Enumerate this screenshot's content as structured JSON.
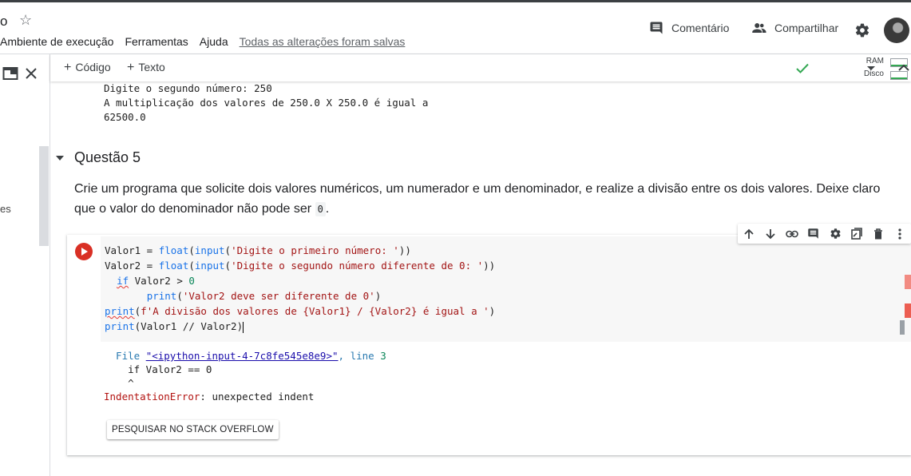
{
  "header": {
    "title_fragment": "o",
    "menu": [
      "Ambiente de execução",
      "Ferramentas",
      "Ajuda"
    ],
    "save_status": "Todas as alterações foram salvas",
    "comment_label": "Comentário",
    "share_label": "Compartilhar"
  },
  "left_panel": {
    "text_fragment": "es"
  },
  "toolbar": {
    "code_label": "Código",
    "text_label": "Texto",
    "ram_label": "RAM",
    "disk_label": "Disco"
  },
  "previous_output": {
    "lines": [
      "Digite o segundo número: 250",
      "A multiplicação dos valores de 250.0 X 250.0 é igual a",
      "62500.0"
    ]
  },
  "section": {
    "title": "Questão 5",
    "description_line1": "Crie um programa que solicite dois valores numéricos, um numerador e um denominador, e realize a divisão entre os dois valores. Deixe claro",
    "description_line2": "que o valor do denominador não pode ser",
    "description_code": "0",
    "description_end": "."
  },
  "code_cell": {
    "line1": {
      "a": "Valor1 = ",
      "fn": "float",
      "b": "(",
      "fn2": "input",
      "c": "(",
      "str": "'Digite o primeiro número: '",
      "d": "))"
    },
    "line2": {
      "a": "Valor2 = ",
      "fn": "float",
      "b": "(",
      "fn2": "input",
      "c": "(",
      "str": "'Digite o segundo número diferente de 0: '",
      "d": "))"
    },
    "line3": {
      "indent": "  ",
      "kw": "if",
      "rest": " Valor2 > ",
      "num": "0"
    },
    "line4": {
      "indent": "       ",
      "fn": "print",
      "b": "(",
      "str": "'Valor2 deve ser diferente de 0'",
      "c": ")"
    },
    "line5": {
      "fn": "print",
      "b": "(",
      "str": "f'A divisão dos valores de {Valor1} / {Valor2} é igual a '",
      "c": ")"
    },
    "line6": {
      "fn": "print",
      "rest": "(Valor1 // Valor2)"
    }
  },
  "cell_output": {
    "file_prefix": "  File ",
    "file_link": "\"<ipython-input-4-7c8fe545e8e9>\"",
    "file_suffix": ", line ",
    "line_no": "3",
    "source_line": "    if Valor2 == 0",
    "caret_line": "    ^",
    "error_name": "IndentationError",
    "error_msg": ": unexpected indent",
    "so_button": "PESQUISAR NO STACK OVERFLOW"
  },
  "colors": {
    "run_button": "#d93025",
    "error_marker": "#ea4335",
    "ok_check": "#34a853",
    "link": "#1a0dab"
  },
  "icons": [
    "star-icon",
    "comment-icon",
    "share-icon",
    "gear-icon",
    "avatar",
    "open-in-tab-icon",
    "close-icon",
    "check-icon",
    "dropdown-icon",
    "collapse-icon",
    "move-up-icon",
    "move-down-icon",
    "link-icon",
    "comment-icon",
    "settings-icon",
    "mirror-cell-icon",
    "delete-icon",
    "more-icon",
    "run-icon"
  ]
}
